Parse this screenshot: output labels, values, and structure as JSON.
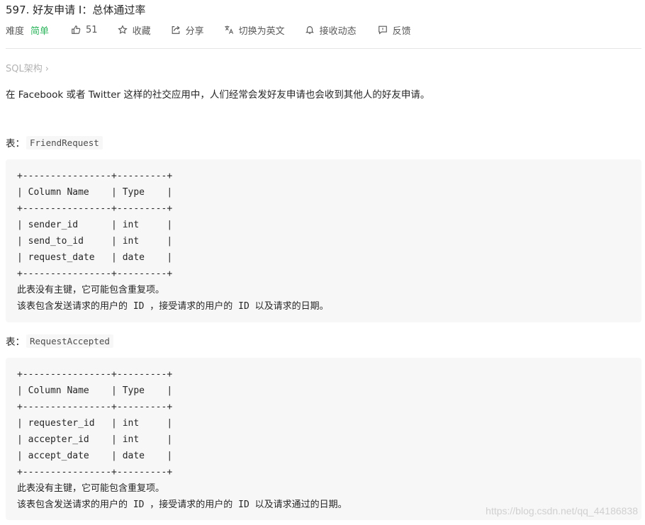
{
  "problem": {
    "title": "597. 好友申请 I：总体通过率",
    "difficulty_label": "难度",
    "difficulty": "简单",
    "likes": "51",
    "favorite_label": "收藏",
    "share_label": "分享",
    "language_label": "切换为英文",
    "follow_label": "接收动态",
    "feedback_label": "反馈"
  },
  "tag": {
    "label": "SQL架构",
    "chevron": "›"
  },
  "description": "在 Facebook 或者 Twitter 这样的社交应用中，人们经常会发好友申请也会收到其他人的好友申请。",
  "tables": [
    {
      "prefix": "表：",
      "name": "FriendRequest",
      "lines": [
        "+----------------+---------+",
        "| Column Name    | Type    |",
        "+----------------+---------+",
        "| sender_id      | int     |",
        "| send_to_id     | int     |",
        "| request_date   | date    |",
        "+----------------+---------+",
        "此表没有主键，它可能包含重复项。",
        "该表包含发送请求的用户的 ID ，接受请求的用户的 ID 以及请求的日期。"
      ]
    },
    {
      "prefix": "表：",
      "name": "RequestAccepted",
      "lines": [
        "+----------------+---------+",
        "| Column Name    | Type    |",
        "+----------------+---------+",
        "| requester_id   | int     |",
        "| accepter_id    | int     |",
        "| accept_date    | date    |",
        "+----------------+---------+",
        "此表没有主键，它可能包含重复项。",
        "该表包含发送请求的用户的 ID ，接受请求的用户的 ID 以及请求通过的日期。"
      ]
    }
  ],
  "watermark": "https://blog.csdn.net/qq_44186838",
  "colors": {
    "difficulty_easy": "#2db55d",
    "code_background": "#f7f7f7",
    "muted_text": "#b3b3b3"
  },
  "icons": [
    "thumbs-up-icon",
    "star-icon",
    "share-icon",
    "translate-icon",
    "bell-icon",
    "feedback-icon"
  ]
}
